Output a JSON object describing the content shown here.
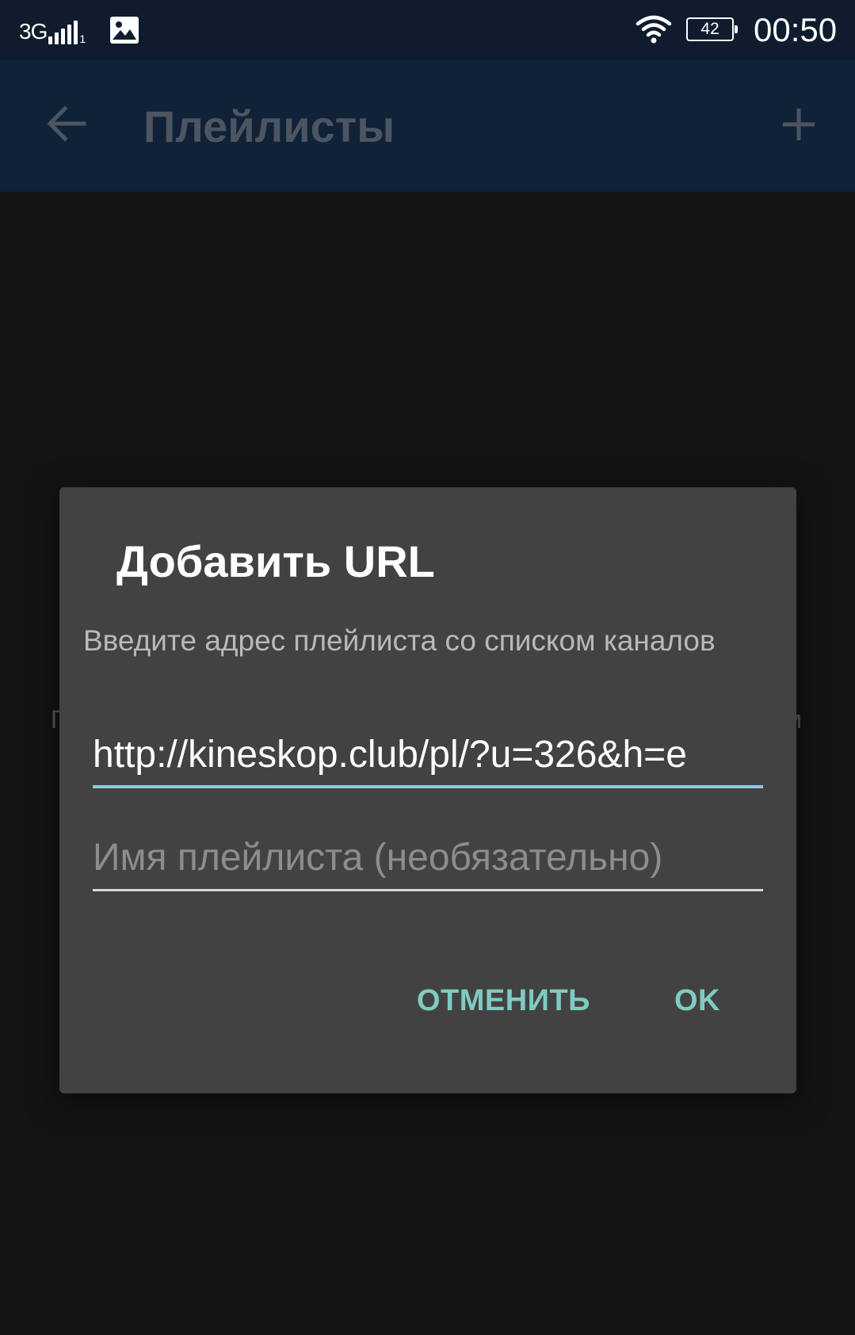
{
  "status_bar": {
    "network": "3G",
    "sim_slot": "1",
    "battery_level": "42",
    "time": "00:50",
    "icons": [
      "signal-icon",
      "gallery-icon",
      "wifi-icon",
      "battery-icon"
    ]
  },
  "app_bar": {
    "title": "Плейлисты",
    "back_icon": "arrow-left-icon",
    "add_icon": "plus-icon"
  },
  "background": {
    "left_fragment": "П",
    "right_fragment": "м"
  },
  "dialog": {
    "title": "Добавить URL",
    "message": "Введите адрес плейлиста со списком каналов",
    "url_value": "http://kineskop.club/pl/?u=326&h=e",
    "name_placeholder": "Имя плейлиста (необязательно)",
    "cancel_label": "ОТМЕНИТЬ",
    "ok_label": "OK"
  },
  "colors": {
    "status_bar_bg": "#0e1c2d",
    "app_bar_bg": "#0f2238",
    "screen_bg": "#141414",
    "dialog_bg": "#424242",
    "accent": "#7fcbc2",
    "focus_underline": "#8ac8e6"
  }
}
